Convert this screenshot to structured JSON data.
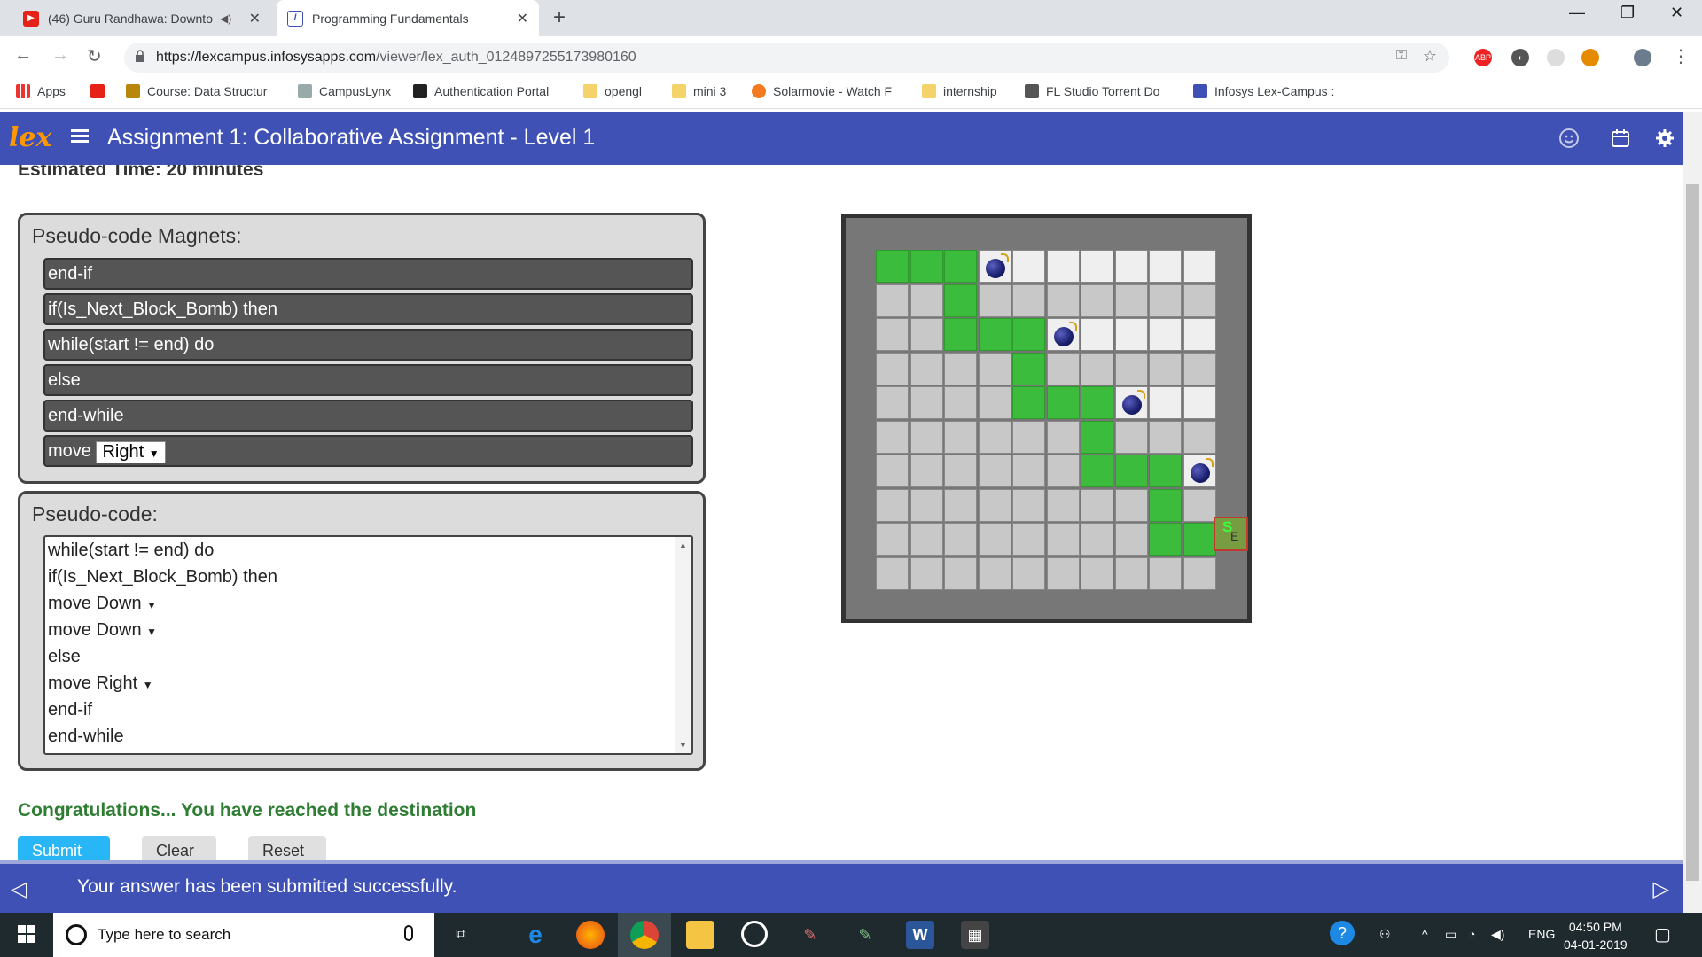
{
  "browser": {
    "tabs": [
      {
        "title": "(46) Guru Randhawa: Downto",
        "icon": "youtube-icon"
      },
      {
        "title": "Programming Fundamentals",
        "icon": "lex-icon"
      }
    ],
    "url_host": "https://lexcampus.infosysapps.com",
    "url_path": "/viewer/lex_auth_0124897255173980160",
    "bookmarks": [
      {
        "label": "Apps"
      },
      {
        "label": ""
      },
      {
        "label": "Course: Data Structur"
      },
      {
        "label": "CampusLynx"
      },
      {
        "label": "Authentication Portal"
      },
      {
        "label": "opengl"
      },
      {
        "label": "mini 3"
      },
      {
        "label": "Solarmovie - Watch F"
      },
      {
        "label": "internship"
      },
      {
        "label": "FL Studio Torrent Do"
      },
      {
        "label": "Infosys Lex-Campus :"
      }
    ]
  },
  "app": {
    "logo": "lex",
    "title": "Assignment 1: Collaborative Assignment - Level 1",
    "estimated_time": "Estimated Time: 20 minutes",
    "magnets_title": "Pseudo-code Magnets:",
    "magnets": [
      "end-if",
      "if(Is_Next_Block_Bomb) then",
      "while(start != end) do",
      "else",
      "end-while"
    ],
    "move_magnet": {
      "label": "move",
      "direction": "Right"
    },
    "pseudocode_title": "Pseudo-code:",
    "pseudocode": [
      {
        "text": "while(start != end) do",
        "dir": ""
      },
      {
        "text": "if(Is_Next_Block_Bomb) then",
        "dir": ""
      },
      {
        "text": "move ",
        "dir": "Down"
      },
      {
        "text": "move ",
        "dir": "Down"
      },
      {
        "text": "else",
        "dir": ""
      },
      {
        "text": "move ",
        "dir": "Right"
      },
      {
        "text": "end-if",
        "dir": ""
      },
      {
        "text": "end-while",
        "dir": ""
      }
    ],
    "congrats": "Congratulations... You have reached the destination",
    "buttons": {
      "submit": "Submit",
      "clear": "Clear",
      "reset": "Reset"
    },
    "toast": "Your answer has been submitted successfully.",
    "goal": {
      "start": "S",
      "end": "E"
    }
  },
  "grid": {
    "rows": [
      "gggbwwwwww",
      "nngnnnnnnn",
      "nngggbwwww",
      "nnnngnnnnn",
      "nnnngggbww",
      "nnnnnngnnn",
      "nnnnnngggb",
      "nnnnnnnngn",
      "nnnnnnnngg",
      "nnnnnnnnnn"
    ]
  },
  "taskbar": {
    "search_placeholder": "Type here to search",
    "language": "ENG",
    "time": "04:50 PM",
    "date": "04-01-2019"
  },
  "colors": {
    "header": "#3f51b5",
    "path_green": "#3cbc3c",
    "congrats_green": "#2e7d32",
    "submit_blue": "#29b6f6"
  }
}
